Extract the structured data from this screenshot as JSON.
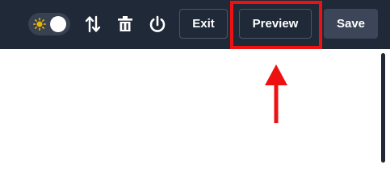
{
  "toolbar": {
    "theme_toggle": {
      "icon": "sun-icon",
      "state": "on"
    },
    "icons": [
      "sort-arrows-icon",
      "trash-icon",
      "power-icon"
    ],
    "exit_label": "Exit",
    "preview_label": "Preview",
    "save_label": "Save"
  },
  "annotation": {
    "color": "#ee1111",
    "target": "preview-button",
    "pointer": "up-arrow"
  },
  "colors": {
    "toolbar_bg": "#1f2937",
    "save_bg": "#3c4658",
    "sun_icon": "#eab308"
  }
}
